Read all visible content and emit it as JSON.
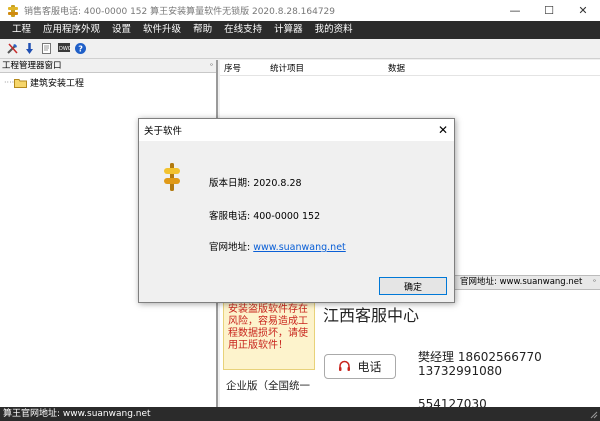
{
  "window": {
    "title": "销售客服电话: 400-0000 152    算王安装算量软件无锁版 2020.8.28.164729",
    "min": "—",
    "max": "☐",
    "close": "✕"
  },
  "menu": {
    "items": [
      "工程",
      "应用程序外观",
      "设置",
      "软件升级",
      "帮助",
      "在线支持",
      "计算器",
      "我的资料"
    ]
  },
  "left_panel": {
    "header": "工程管理器窗口",
    "pin": "ᵒ",
    "tree_dots": "·····",
    "tree_item": "建筑安装工程"
  },
  "table": {
    "headers": [
      "序号",
      "统计项目",
      "数据"
    ]
  },
  "ad_bar": {
    "text": "官网地址: www.suanwang.net",
    "pin": "ᵒ"
  },
  "ad": {
    "warning": "安装盗版软件存在风险，容易造成工程数据损坏，请使用正版软件！",
    "enterprise": "企业版（全国统一",
    "service_title": "江西客服中心",
    "phone_label": "电话",
    "contact1": "樊经理 18602566770",
    "contact2": "13732991080",
    "contact3": "554127030"
  },
  "status": {
    "text": "算王官网地址: www.suanwang.net"
  },
  "dialog": {
    "title": "关于软件",
    "close": "✕",
    "version": "版本日期: 2020.8.28",
    "phone": "客服电话: 400-0000 152",
    "website_label": "官网地址: ",
    "website_url": "www.suanwang.net",
    "ok": "确定"
  },
  "colors": {
    "menubar": "#2b2b2b",
    "link": "#0a5fd6",
    "warning_text": "#c8241d"
  }
}
